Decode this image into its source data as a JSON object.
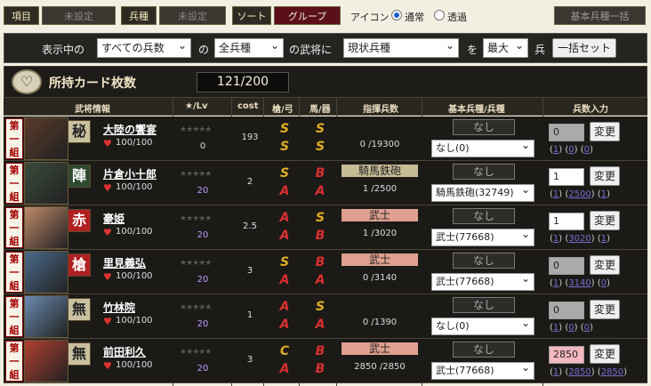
{
  "toolbar": {
    "item_label": "項目",
    "item_value": "未設定",
    "type_label": "兵種",
    "type_value": "未設定",
    "sort_label": "ソート",
    "group_label": "グループ",
    "icon_label": "アイコン",
    "normal_label": "通常",
    "transparent_label": "透過",
    "bulk_button": "基本兵種一括"
  },
  "filter": {
    "prefix": "表示中の",
    "all_troops": "すべての兵数",
    "of": "の",
    "all_types": "全兵種",
    "for_general": "の武将に",
    "current_type": "現状兵種",
    "wo": "を",
    "max": "最大",
    "hei": "兵",
    "set_button": "一括セット"
  },
  "count": {
    "title": "所持カード枚数",
    "value": "121/200",
    "emblem": "♡"
  },
  "header": {
    "card": "武将情報",
    "star": "★/Lv",
    "cost": "cost",
    "spear": "槍/弓",
    "horse": "馬/器",
    "cmd": "指揮兵数",
    "base": "基本兵種/兵種",
    "input": "兵数入力"
  },
  "colors": {
    "S": "#e0b020",
    "A": "#d83030",
    "B": "#d83030",
    "C": "#e0b020"
  },
  "rows": [
    {
      "group_tag": "第一組",
      "kanji": "秘",
      "kanji_bg": "#c9c0a0",
      "kanji_color": "#222",
      "portrait": "#5a3a2a",
      "name": "大陸の饗宴",
      "hp": "100/100",
      "lv": "0",
      "cost": "193",
      "ranks": [
        "S",
        "S",
        "S",
        "S"
      ],
      "troop_name": "",
      "troop_bg": "",
      "troop_count": "0 /19300",
      "nashi": "なし",
      "base": "なし(0)",
      "input": "0",
      "input_bg": "#aaa",
      "links": [
        "1",
        "0",
        "0"
      ]
    },
    {
      "group_tag": "第一組",
      "kanji": "陣",
      "kanji_bg": "#2f4a30",
      "kanji_color": "#fff",
      "portrait": "#3a4a3a",
      "name": "片倉小十郎",
      "hp": "100/100",
      "lv": "20",
      "cost": "2",
      "ranks": [
        "S",
        "A",
        "B",
        "A"
      ],
      "troop_name": "騎馬鉄砲",
      "troop_bg": "#c7bb96",
      "troop_count": "1 /2500",
      "nashi": "なし",
      "base": "騎馬鉄砲(32749)",
      "input": "1",
      "input_bg": "#fff",
      "links": [
        "1",
        "2500",
        "1"
      ]
    },
    {
      "group_tag": "第一組",
      "kanji": "赤",
      "kanji_bg": "#b02020",
      "kanji_color": "#fff",
      "portrait": "#c08a6a",
      "name": "豪姫",
      "hp": "100/100",
      "lv": "20",
      "cost": "2.5",
      "ranks": [
        "A",
        "A",
        "S",
        "B"
      ],
      "troop_name": "武士",
      "troop_bg": "#e0a090",
      "troop_count": "1 /3020",
      "nashi": "なし",
      "base": "武士(77668)",
      "input": "1",
      "input_bg": "#fff",
      "links": [
        "1",
        "3020",
        "1"
      ]
    },
    {
      "group_tag": "第一組",
      "kanji": "槍",
      "kanji_bg": "#b02020",
      "kanji_color": "#fff",
      "portrait": "#4a6a8a",
      "name": "里見義弘",
      "hp": "100/100",
      "lv": "20",
      "cost": "3",
      "ranks": [
        "S",
        "A",
        "B",
        "A"
      ],
      "troop_name": "武士",
      "troop_bg": "#e0a090",
      "troop_count": "0 /3140",
      "nashi": "なし",
      "base": "武士(77668)",
      "input": "0",
      "input_bg": "#aaa",
      "links": [
        "1",
        "3140",
        "0"
      ]
    },
    {
      "group_tag": "第一組",
      "kanji": "無",
      "kanji_bg": "#c9c0a0",
      "kanji_color": "#222",
      "portrait": "#6a8ab0",
      "name": "竹林院",
      "hp": "100/100",
      "lv": "20",
      "cost": "1",
      "ranks": [
        "A",
        "A",
        "S",
        "A"
      ],
      "troop_name": "",
      "troop_bg": "",
      "troop_count": "0 /1390",
      "nashi": "なし",
      "base": "なし(0)",
      "input": "0",
      "input_bg": "#aaa",
      "links": [
        "1",
        "0",
        "0"
      ]
    },
    {
      "group_tag": "第一組",
      "kanji": "無",
      "kanji_bg": "#c9c0a0",
      "kanji_color": "#222",
      "portrait": "#b04030",
      "name": "前田利久",
      "hp": "100/100",
      "lv": "20",
      "cost": "3",
      "ranks": [
        "C",
        "A",
        "B",
        "B"
      ],
      "troop_name": "武士",
      "troop_bg": "#e0a090",
      "troop_count": "2850 /2850",
      "nashi": "なし",
      "base": "武士(77668)",
      "input": "2850",
      "input_bg": "#f4b8c0",
      "links": [
        "1",
        "2850",
        "2850"
      ]
    }
  ]
}
